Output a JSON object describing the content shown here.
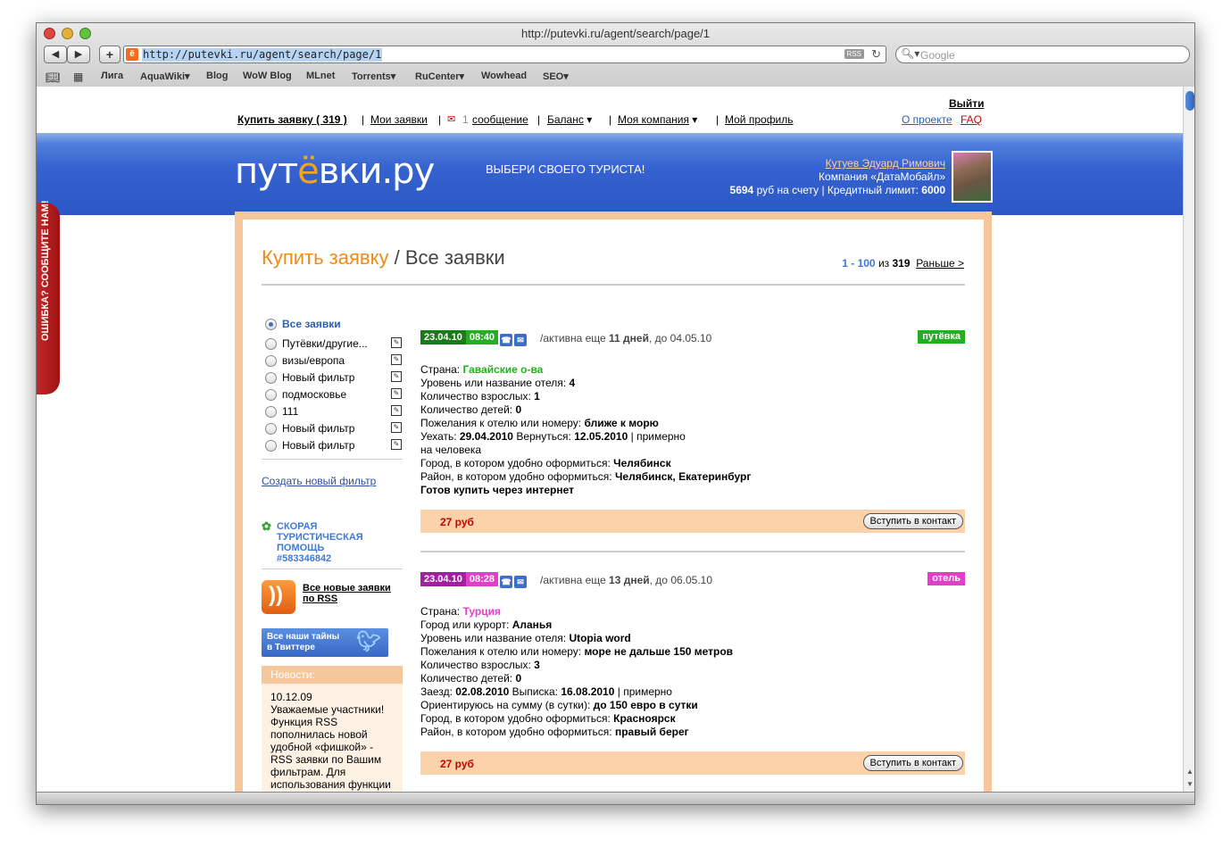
{
  "window": {
    "title": "http://putevki.ru/agent/search/page/1"
  },
  "toolbar": {
    "back": "◀",
    "forward": "▶",
    "add": "+",
    "url": "http://putevki.ru/agent/search/page/1",
    "rss_badge": "RSS",
    "search_placeholder": "Google"
  },
  "bookmarks": [
    "Лига",
    "AquaWiki▾",
    "Blog",
    "WoW Blog",
    "MLnet",
    "Torrents▾",
    "RuCenter▾",
    "Wowhead",
    "SEO▾"
  ],
  "topnav": {
    "buy": "Купить заявку ( 319 )",
    "my_orders": "Мои заявки",
    "msg_count": "1",
    "msg": "сообщение",
    "balance": "Баланс",
    "company": "Моя компания",
    "profile": "Мой профиль",
    "logout": "Выйти",
    "about": "О проекте",
    "faq": "FAQ"
  },
  "header": {
    "logo_a": "пут",
    "logo_yo": "ё",
    "logo_b": "вки.ру",
    "slogan": "ВЫБЕРИ СВОЕГО ТУРИСТА!",
    "user_name": "Кутуев Эдуард Римович",
    "company": "Компания «ДатаМобайл»",
    "balance_num": "5694",
    "balance_text": " руб на счету | Кредитный лимит:",
    "credit_num": "6000"
  },
  "page": {
    "crumb_link": "Купить заявку",
    "crumb_sep": " / ",
    "crumb_current": "Все заявки",
    "pager_range": "1 - 100",
    "pager_of": " из ",
    "pager_total": "319",
    "pager_next": "Раньше >"
  },
  "sidebar": {
    "filters": [
      {
        "label": "Все заявки"
      },
      {
        "label": "Путёвки/другие..."
      },
      {
        "label": "визы/европа"
      },
      {
        "label": "Новый фильтр"
      },
      {
        "label": "подмосковье"
      },
      {
        "label": "111"
      },
      {
        "label": "Новый фильтр"
      },
      {
        "label": "Новый фильтр"
      }
    ],
    "new_filter": "Создать новый фильтр",
    "help_l1": "СКОРАЯ",
    "help_l2": "ТУРИСТИЧЕСКАЯ",
    "help_l3": "ПОМОЩЬ",
    "help_l4": "#583346842",
    "rss_text": "Все новые заявки по RSS",
    "twitter_text": "Все наши тайны в Твиттере",
    "news_header": "Новости:",
    "news_date": "10.12.09",
    "news_text": "Уважаемые участники! Функция RSS пополнилась новой удобной «фишкой» - RSS заявки по Вашим фильтрам. Для использования функции выберите фильтр"
  },
  "listings": [
    {
      "date": "23.04.10",
      "time": "08:40",
      "status_a": "/активна еще ",
      "status_b": "11 дней",
      "status_c": ", до 04.05.10",
      "tag": "путёвка",
      "tag_color": "#22b022",
      "date_color": "#1a7a1a",
      "time_color": "#22b022",
      "country_color": "#22b022",
      "lines": [
        {
          "k": "Страна: ",
          "v": "Гавайские о-ва",
          "country": true
        },
        {
          "k": "Уровень или название отеля: ",
          "v": "4"
        },
        {
          "k": "Количество взрослых: ",
          "v": "1"
        },
        {
          "k": "Количество детей: ",
          "v": "0"
        },
        {
          "k": "Пожелания к отелю или номеру: ",
          "v": "ближе к морю"
        },
        {
          "k": "Уехать: ",
          "v": "29.04.2010",
          "k2": " Вернуться: ",
          "v2": "12.05.2010",
          "k3": " | примерно"
        },
        {
          "k": "на человека",
          "v": ""
        },
        {
          "k": "Город, в котором удобно оформиться: ",
          "v": "Челябинск"
        },
        {
          "k": "Район, в котором удобно оформиться: ",
          "v": "Челябинск, Екатеринбург"
        },
        {
          "k": "",
          "v": "Готов купить через интернет"
        }
      ],
      "price": "27 руб",
      "button": "Вступить в контакт"
    },
    {
      "date": "23.04.10",
      "time": "08:28",
      "status_a": "/активна еще ",
      "status_b": "13 дней",
      "status_c": ", до 06.05.10",
      "tag": "отель",
      "tag_color": "#e040c8",
      "date_color": "#a020a0",
      "time_color": "#e040c8",
      "country_color": "#e040c8",
      "lines": [
        {
          "k": "Страна: ",
          "v": "Турция",
          "country": true
        },
        {
          "k": "Город или курорт: ",
          "v": "Аланья"
        },
        {
          "k": "Уровень или название отеля: ",
          "v": "Utopia word"
        },
        {
          "k": "Пожелания к отелю или номеру: ",
          "v": "море не дальше 150 метров"
        },
        {
          "k": "Количество взрослых: ",
          "v": "3"
        },
        {
          "k": "Количество детей: ",
          "v": "0"
        },
        {
          "k": "Заезд: ",
          "v": "02.08.2010",
          "k2": " Выписка: ",
          "v2": "16.08.2010",
          "k3": " | примерно"
        },
        {
          "k": "Ориентируюсь на сумму (в сутки): ",
          "v": "до 150 евро в сутки"
        },
        {
          "k": "Город, в котором удобно оформиться: ",
          "v": "Красноярск"
        },
        {
          "k": "Район, в котором удобно оформиться: ",
          "v": "правый берег"
        }
      ],
      "price": "27 руб",
      "button": "Вступить в контакт"
    }
  ],
  "error_tab": "ОШИБКА? СООБЩИТЕ НАМ!"
}
